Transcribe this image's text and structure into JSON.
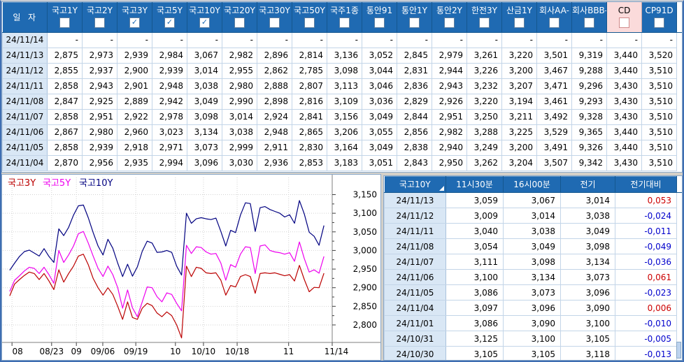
{
  "colors": {
    "header_blue": "#1F6AB2",
    "highlight_pink": "#FBDBDB",
    "positive_red": "#CC0000",
    "negative_blue": "#0000CC",
    "date_column_bg": "#D9E7F5",
    "grid_line": "#C3D5E8"
  },
  "top_table": {
    "corner_label": "일  자",
    "columns": [
      {
        "label": "국고1Y",
        "checked": false,
        "highlight": false
      },
      {
        "label": "국고2Y",
        "checked": false,
        "highlight": false
      },
      {
        "label": "국고3Y",
        "checked": true,
        "highlight": false
      },
      {
        "label": "국고5Y",
        "checked": true,
        "highlight": false
      },
      {
        "label": "국고10Y",
        "checked": true,
        "highlight": false
      },
      {
        "label": "국고20Y",
        "checked": false,
        "highlight": false
      },
      {
        "label": "국고30Y",
        "checked": false,
        "highlight": false
      },
      {
        "label": "국고50Y",
        "checked": false,
        "highlight": false
      },
      {
        "label": "국주1종",
        "checked": false,
        "highlight": false
      },
      {
        "label": "통안91",
        "checked": false,
        "highlight": false
      },
      {
        "label": "통안1Y",
        "checked": false,
        "highlight": false
      },
      {
        "label": "통안2Y",
        "checked": false,
        "highlight": false
      },
      {
        "label": "한전3Y",
        "checked": false,
        "highlight": false
      },
      {
        "label": "산금1Y",
        "checked": false,
        "highlight": false
      },
      {
        "label": "회사AA-",
        "checked": false,
        "highlight": false
      },
      {
        "label": "회사BBB-",
        "checked": false,
        "highlight": false
      },
      {
        "label": "CD",
        "checked": false,
        "highlight": true
      },
      {
        "label": "CP91D",
        "checked": false,
        "highlight": false
      }
    ],
    "rows": [
      {
        "date": "24/11/14",
        "values": [
          "-",
          "-",
          "-",
          "-",
          "-",
          "-",
          "-",
          "-",
          "-",
          "-",
          "-",
          "-",
          "-",
          "-",
          "-",
          "-",
          "-",
          "-"
        ]
      },
      {
        "date": "24/11/13",
        "values": [
          "2,875",
          "2,973",
          "2,939",
          "2,984",
          "3,067",
          "2,982",
          "2,896",
          "2,814",
          "3,136",
          "3,052",
          "2,845",
          "2,979",
          "3,261",
          "3,220",
          "3,501",
          "9,319",
          "3,440",
          "3,520"
        ]
      },
      {
        "date": "24/11/12",
        "values": [
          "2,855",
          "2,937",
          "2,900",
          "2,939",
          "3,014",
          "2,955",
          "2,862",
          "2,785",
          "3,098",
          "3,044",
          "2,831",
          "2,944",
          "3,226",
          "3,200",
          "3,467",
          "9,288",
          "3,440",
          "3,510"
        ]
      },
      {
        "date": "24/11/11",
        "values": [
          "2,858",
          "2,943",
          "2,901",
          "2,948",
          "3,038",
          "2,980",
          "2,888",
          "2,807",
          "3,113",
          "3,046",
          "2,836",
          "2,943",
          "3,232",
          "3,207",
          "3,471",
          "9,296",
          "3,430",
          "3,510"
        ]
      },
      {
        "date": "24/11/08",
        "values": [
          "2,847",
          "2,925",
          "2,889",
          "2,942",
          "3,049",
          "2,990",
          "2,898",
          "2,816",
          "3,109",
          "3,036",
          "2,829",
          "2,926",
          "3,220",
          "3,194",
          "3,461",
          "9,293",
          "3,430",
          "3,510"
        ]
      },
      {
        "date": "24/11/07",
        "values": [
          "2,858",
          "2,951",
          "2,922",
          "2,978",
          "3,098",
          "3,014",
          "2,924",
          "2,841",
          "3,156",
          "3,049",
          "2,844",
          "2,951",
          "3,250",
          "3,211",
          "3,492",
          "9,328",
          "3,430",
          "3,510"
        ]
      },
      {
        "date": "24/11/06",
        "values": [
          "2,867",
          "2,980",
          "2,960",
          "3,023",
          "3,134",
          "3,038",
          "2,948",
          "2,865",
          "3,206",
          "3,055",
          "2,856",
          "2,982",
          "3,288",
          "3,225",
          "3,529",
          "9,365",
          "3,440",
          "3,510"
        ]
      },
      {
        "date": "24/11/05",
        "values": [
          "2,858",
          "2,939",
          "2,918",
          "2,971",
          "3,073",
          "2,999",
          "2,911",
          "2,830",
          "3,164",
          "3,049",
          "2,838",
          "2,940",
          "3,249",
          "3,200",
          "3,491",
          "9,326",
          "3,440",
          "3,510"
        ]
      },
      {
        "date": "24/11/04",
        "values": [
          "2,870",
          "2,956",
          "2,935",
          "2,994",
          "3,096",
          "3,030",
          "2,936",
          "2,853",
          "3,183",
          "3,051",
          "2,843",
          "2,950",
          "3,262",
          "3,204",
          "3,507",
          "9,342",
          "3,430",
          "3,510"
        ]
      }
    ]
  },
  "right_table": {
    "columns": [
      "국고10Y",
      "11시30분",
      "16시00분",
      "전기",
      "전기대비"
    ],
    "rows": [
      {
        "date": "24/11/13",
        "values": [
          "3,059",
          "3,067",
          "3,014",
          "0,053"
        ]
      },
      {
        "date": "24/11/12",
        "values": [
          "3,009",
          "3,014",
          "3,038",
          "-0,024"
        ]
      },
      {
        "date": "24/11/11",
        "values": [
          "3,040",
          "3,038",
          "3,049",
          "-0,011"
        ]
      },
      {
        "date": "24/11/08",
        "values": [
          "3,054",
          "3,049",
          "3,098",
          "-0,049"
        ]
      },
      {
        "date": "24/11/07",
        "values": [
          "3,111",
          "3,098",
          "3,134",
          "-0,036"
        ]
      },
      {
        "date": "24/11/06",
        "values": [
          "3,100",
          "3,134",
          "3,073",
          "0,061"
        ]
      },
      {
        "date": "24/11/05",
        "values": [
          "3,086",
          "3,073",
          "3,096",
          "-0,023"
        ]
      },
      {
        "date": "24/11/04",
        "values": [
          "3,097",
          "3,096",
          "3,090",
          "0,006"
        ]
      },
      {
        "date": "24/11/01",
        "values": [
          "3,086",
          "3,090",
          "3,100",
          "-0,010"
        ]
      },
      {
        "date": "24/10/31",
        "values": [
          "3,125",
          "3,100",
          "3,105",
          "-0,005"
        ]
      },
      {
        "date": "24/10/30",
        "values": [
          "3,105",
          "3,105",
          "3,118",
          "-0,013"
        ]
      }
    ]
  },
  "chart_data": {
    "type": "line",
    "title": "",
    "legend_position": "top-left",
    "grid": "dotted",
    "x_ticks": [
      "08",
      "08/23",
      "09",
      "09/06",
      "09/19",
      "10",
      "10/10",
      "10/18",
      "11",
      "11/14"
    ],
    "x_tick_fracs": [
      0.03,
      0.15,
      0.225,
      0.305,
      0.405,
      0.525,
      0.61,
      0.712,
      0.868,
      1.0
    ],
    "y_ticks": [
      "3,150",
      "3,100",
      "3,050",
      "3,000",
      "2,950",
      "2,900",
      "2,850",
      "2,800"
    ],
    "y_grid_values": [
      3.15,
      3.1,
      3.05,
      3.0,
      2.95,
      2.9,
      2.85,
      2.8
    ],
    "y_range": [
      2.753,
      3.196
    ],
    "x_data_frac": [
      0.023,
      0.975
    ],
    "series": [
      {
        "name": "국고3Y",
        "color": "#BB0000",
        "values": [
          2.878,
          2.91,
          2.922,
          2.933,
          2.942,
          2.938,
          2.922,
          2.938,
          2.918,
          2.895,
          2.948,
          2.915,
          2.938,
          2.958,
          2.985,
          2.99,
          2.962,
          2.925,
          2.9,
          2.88,
          2.9,
          2.882,
          2.85,
          2.815,
          2.862,
          2.82,
          2.815,
          2.845,
          2.858,
          2.852,
          2.832,
          2.822,
          2.835,
          2.825,
          2.8,
          2.765,
          2.958,
          2.93,
          2.955,
          2.952,
          2.94,
          2.938,
          2.94,
          2.92,
          2.88,
          2.906,
          2.902,
          2.93,
          2.935,
          2.93,
          2.885,
          2.938,
          2.94,
          2.938,
          2.94,
          2.936,
          2.932,
          2.935,
          2.918,
          2.96,
          2.922,
          2.889,
          2.901,
          2.9,
          2.939
        ]
      },
      {
        "name": "국고5Y",
        "color": "#EE00EE",
        "values": [
          2.89,
          2.92,
          2.932,
          2.945,
          2.955,
          2.952,
          2.938,
          2.955,
          2.935,
          2.912,
          3.0,
          2.968,
          2.988,
          3.012,
          3.045,
          3.051,
          3.02,
          2.985,
          2.952,
          2.93,
          2.958,
          2.935,
          2.9,
          2.845,
          2.894,
          2.846,
          2.822,
          2.862,
          2.902,
          2.9,
          2.876,
          2.862,
          2.886,
          2.882,
          2.858,
          2.838,
          3.014,
          2.992,
          3.01,
          3.008,
          2.996,
          2.99,
          2.992,
          2.966,
          2.92,
          2.962,
          2.955,
          2.99,
          3.01,
          3.008,
          2.938,
          3.012,
          3.015,
          3.0,
          2.996,
          2.994,
          2.99,
          2.994,
          2.971,
          3.023,
          2.978,
          2.942,
          2.948,
          2.939,
          2.984
        ]
      },
      {
        "name": "국고10Y",
        "color": "#000080",
        "values": [
          2.947,
          2.966,
          2.984,
          2.997,
          3.001,
          2.993,
          2.985,
          3.005,
          2.984,
          2.968,
          3.058,
          3.04,
          3.062,
          3.095,
          3.12,
          3.122,
          3.088,
          3.048,
          3.012,
          2.988,
          3.03,
          3.006,
          2.966,
          2.93,
          2.963,
          2.931,
          2.956,
          2.998,
          3.025,
          3.02,
          2.995,
          2.996,
          3.0,
          2.995,
          2.958,
          2.934,
          3.1,
          3.073,
          3.085,
          3.088,
          3.085,
          3.083,
          3.087,
          3.051,
          3.012,
          3.054,
          3.048,
          3.095,
          3.128,
          3.126,
          3.051,
          3.115,
          3.118,
          3.11,
          3.105,
          3.1,
          3.09,
          3.096,
          3.073,
          3.134,
          3.098,
          3.049,
          3.038,
          3.014,
          3.067
        ]
      }
    ]
  }
}
